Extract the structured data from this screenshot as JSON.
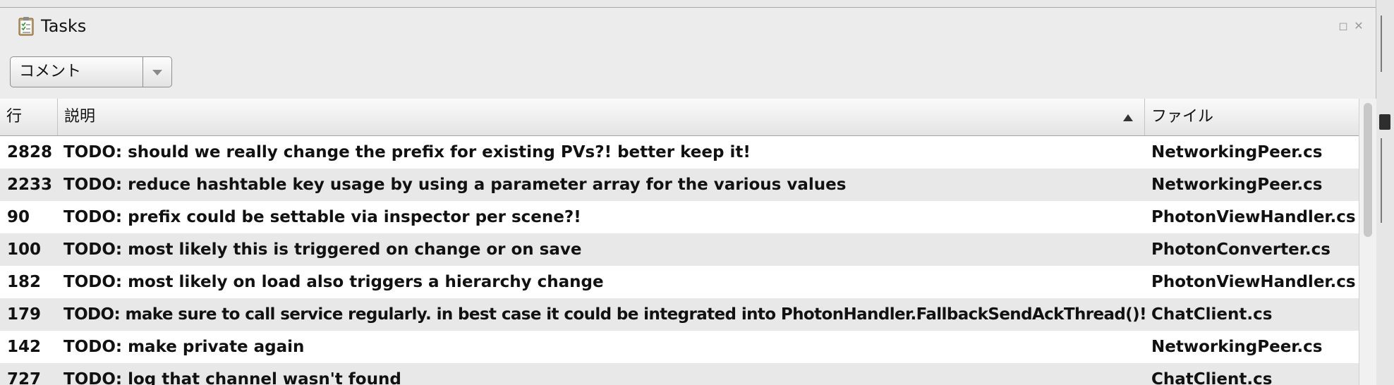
{
  "panel": {
    "title": "Tasks",
    "icon": "clipboard-checklist-icon",
    "controls": [
      "maximize-icon",
      "close-icon"
    ]
  },
  "filter": {
    "selected": "コメント"
  },
  "table": {
    "columns": {
      "line": "行",
      "description": "説明",
      "file": "ファイル"
    },
    "sort": {
      "column": "説明",
      "direction": "ascending"
    },
    "rows": [
      {
        "line": "2828",
        "description": "TODO: should we really change the prefix for existing PVs?! better keep it!",
        "file": "NetworkingPeer.cs"
      },
      {
        "line": "2233",
        "description": "TODO: reduce hashtable key usage by using a parameter array for the various values",
        "file": "NetworkingPeer.cs"
      },
      {
        "line": "90",
        "description": "TODO: prefix could be settable via inspector per scene?!",
        "file": "PhotonViewHandler.cs"
      },
      {
        "line": "100",
        "description": "TODO: most likely this is triggered on change or on save",
        "file": "PhotonConverter.cs"
      },
      {
        "line": "182",
        "description": "TODO: most likely on load also triggers a hierarchy change",
        "file": "PhotonViewHandler.cs"
      },
      {
        "line": "179",
        "description": "TODO: make sure to call service regularly. in best case it could be integrated into PhotonHandler.FallbackSendAckThread()!",
        "file": "ChatClient.cs"
      },
      {
        "line": "142",
        "description": "TODO: make private again",
        "file": "NetworkingPeer.cs"
      },
      {
        "line": "727",
        "description": "TODO: log that channel wasn't found",
        "file": "ChatClient.cs"
      }
    ]
  }
}
